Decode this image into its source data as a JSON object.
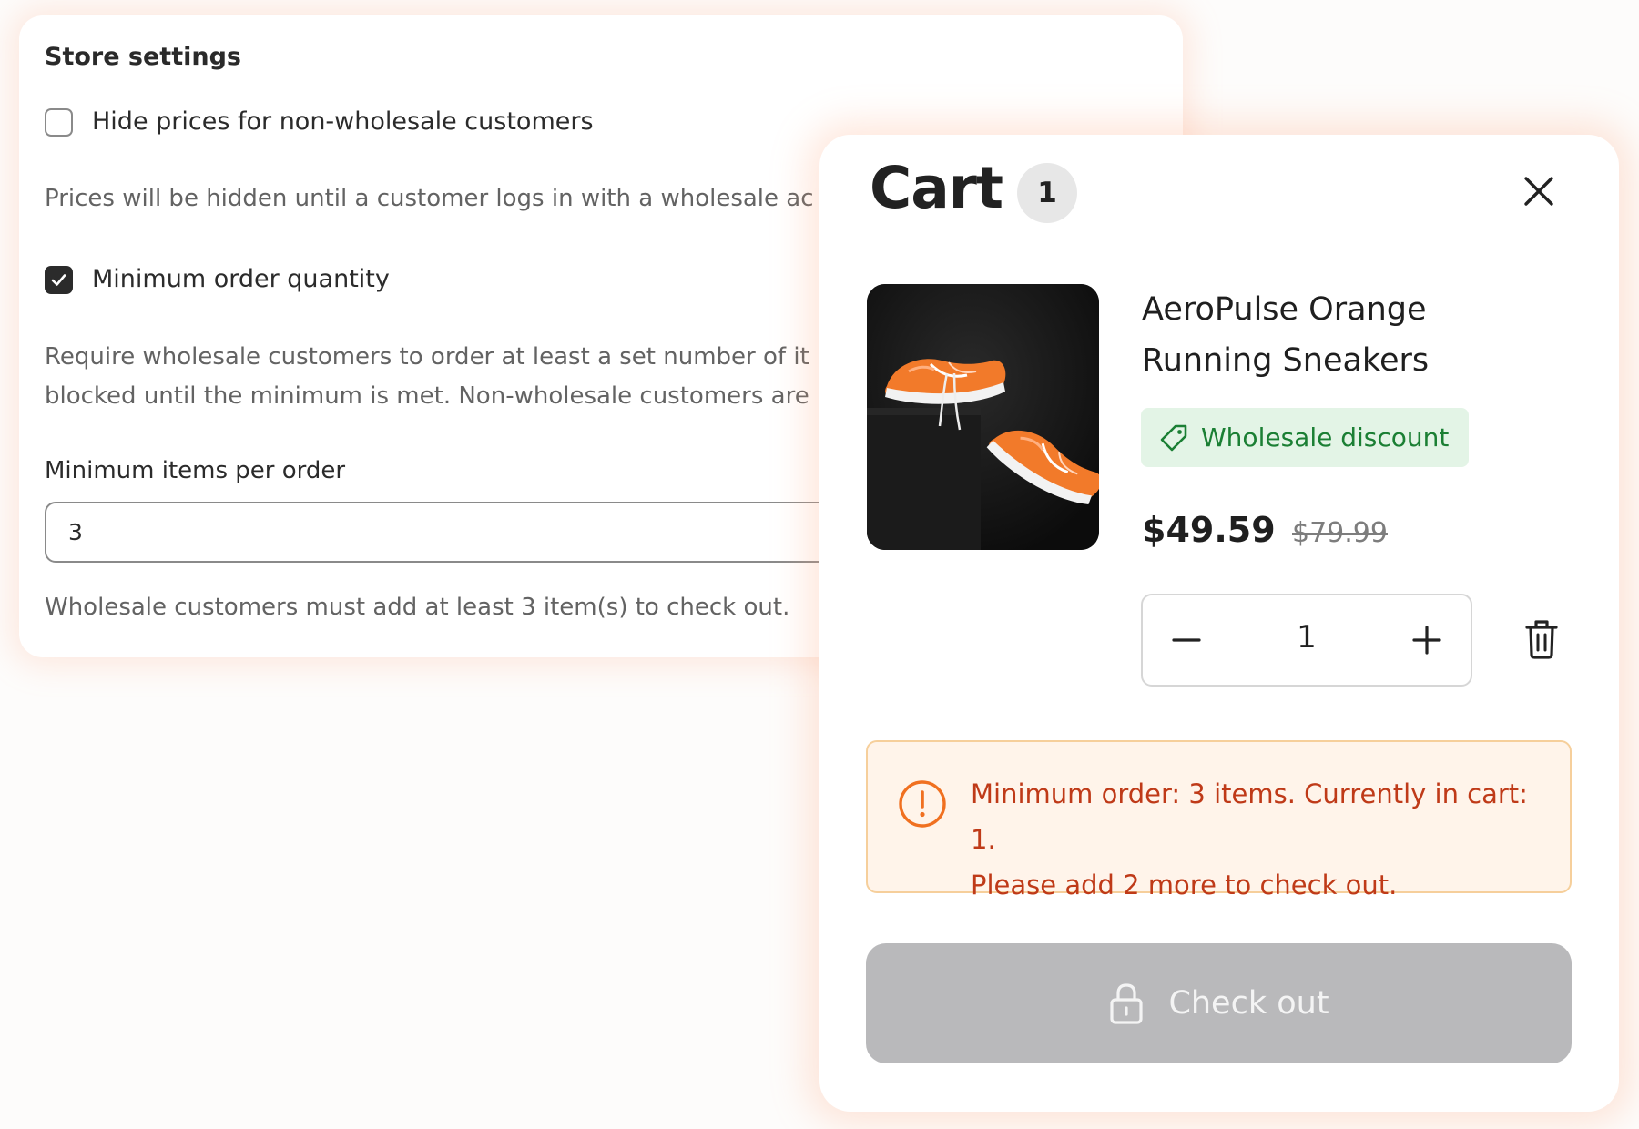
{
  "settings": {
    "title": "Store settings",
    "hide_prices": {
      "label": "Hide prices for non-wholesale customers",
      "checked": false,
      "help": "Prices will be hidden until a customer logs in with a wholesale ac"
    },
    "min_order": {
      "label": "Minimum order quantity",
      "checked": true,
      "help_line1": "Require wholesale customers to order at least a set number of it",
      "help_line2": "blocked until the minimum is met. Non-wholesale customers are"
    },
    "min_items": {
      "label": "Minimum items per order",
      "value": "3",
      "help": "Wholesale customers must add at least 3 item(s) to check out."
    }
  },
  "cart": {
    "title": "Cart",
    "count": "1",
    "item": {
      "name": "AeroPulse Orange Running Sneakers",
      "badge": "Wholesale discount",
      "price": "$49.59",
      "original_price": "$79.99",
      "quantity": "1"
    },
    "alert": {
      "line1": "Minimum order: 3 items. Currently in cart: 1.",
      "line2": "Please add 2 more to check out."
    },
    "checkout_label": "Check out"
  },
  "colors": {
    "accent_orange": "#f07020",
    "discount_green": "#1b7f34",
    "alert_text": "#bf3a18",
    "disabled_button": "#b9b9bb"
  },
  "icons": [
    "check-icon",
    "close-icon",
    "tag-icon",
    "minus-icon",
    "plus-icon",
    "trash-icon",
    "alert-icon",
    "lock-icon"
  ]
}
